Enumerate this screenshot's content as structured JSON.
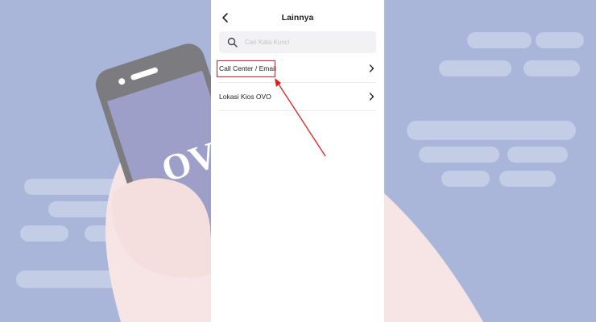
{
  "background": {
    "phone_brand_text": "OVO",
    "color": "#a9b6da"
  },
  "header": {
    "title": "Lainnya",
    "back_icon": "chevron-left-icon"
  },
  "search": {
    "placeholder": "Cari Kata Kunci",
    "value": "",
    "icon": "search-icon"
  },
  "menu": {
    "items": [
      {
        "label": "Call Center / Email",
        "icon": "chevron-right-icon",
        "highlighted": true
      },
      {
        "label": "Lokasi Kios OVO",
        "icon": "chevron-right-icon",
        "highlighted": false
      }
    ]
  },
  "annotation": {
    "color": "#e11d1d"
  }
}
